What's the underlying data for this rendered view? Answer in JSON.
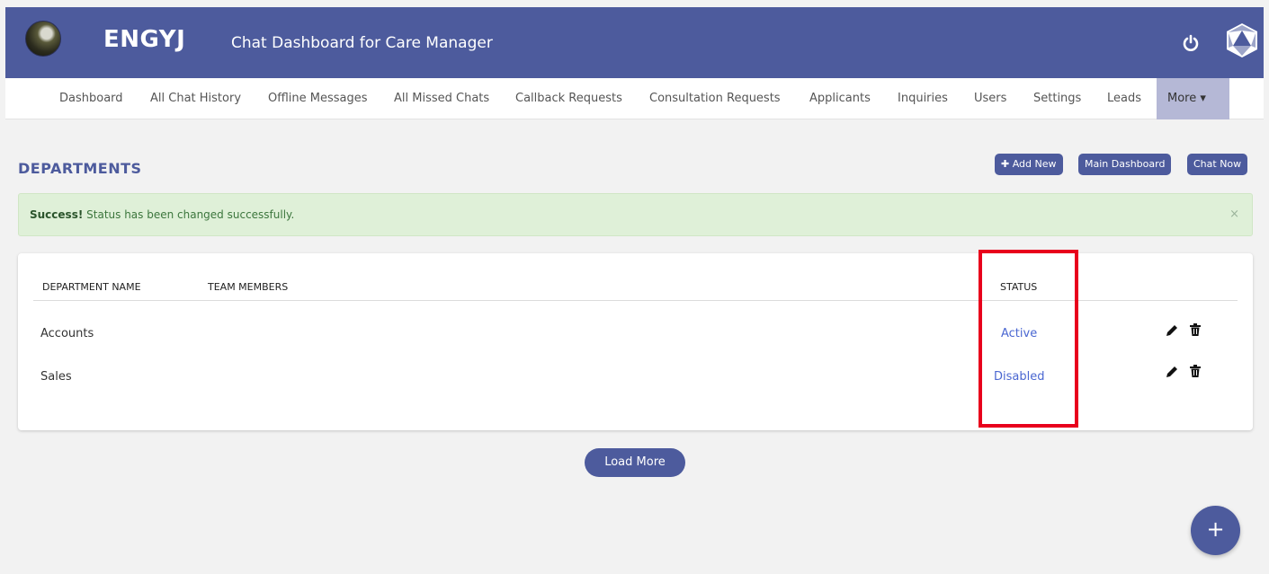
{
  "header": {
    "brand": "ENGYJ",
    "subtitle": "Chat Dashboard for Care Manager",
    "color": "#4d5b9d"
  },
  "nav": {
    "items": [
      {
        "label": "Dashboard"
      },
      {
        "label": "All Chat History"
      },
      {
        "label": "Offline Messages"
      },
      {
        "label": "All Missed Chats"
      },
      {
        "label": "Callback Requests"
      },
      {
        "label": "Consultation Requests"
      },
      {
        "label": "Applicants"
      },
      {
        "label": "Inquiries"
      },
      {
        "label": "Users"
      },
      {
        "label": "Settings"
      },
      {
        "label": "Leads"
      },
      {
        "label": "More ▾"
      }
    ]
  },
  "page": {
    "title": "DEPARTMENTS",
    "actions": {
      "add_new": "✚ Add New",
      "main_dashboard": "Main Dashboard",
      "chat_now": "Chat Now"
    }
  },
  "alert": {
    "strong": "Success!",
    "message": "Status has been changed successfully.",
    "close": "×"
  },
  "table": {
    "headers": {
      "name": "DEPARTMENT NAME",
      "members": "TEAM MEMBERS",
      "status": "STATUS"
    },
    "rows": [
      {
        "name": "Accounts",
        "members": "",
        "status": "Active"
      },
      {
        "name": "Sales",
        "members": "",
        "status": "Disabled"
      }
    ]
  },
  "load_more": "Load More",
  "fab": "+",
  "icons": {
    "power": "power-icon",
    "settings": "d20-icon",
    "edit": "pencil-icon",
    "delete": "trash-icon"
  }
}
